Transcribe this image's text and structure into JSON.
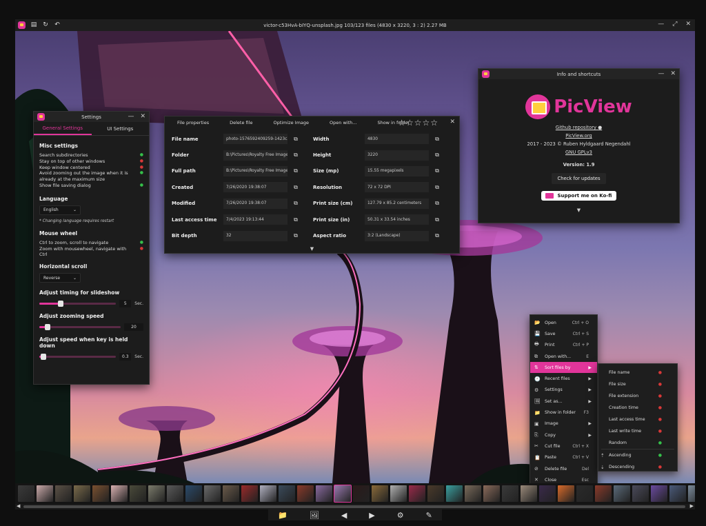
{
  "window": {
    "title": "victor-c53HvA-bIYQ-unsplash.jpg 103/123 files (4830 x 3220, 3 : 2) 2.27 MB",
    "controls": [
      "—",
      "⤢",
      "✕"
    ]
  },
  "settings": {
    "title": "Settings",
    "tabs": [
      "General Settings",
      "UI Settings"
    ],
    "misc_heading": "Misc settings",
    "misc_items": [
      {
        "label": "Search subdirectories",
        "on": true
      },
      {
        "label": "Stay on top of other windows",
        "on": false
      },
      {
        "label": "Keep window centered",
        "on": false
      },
      {
        "label": "Avoid zooming out the image when it is already at the maximum size",
        "on": true
      },
      {
        "label": "Show file saving dialog",
        "on": true
      }
    ],
    "language_heading": "Language",
    "language_value": "English",
    "language_note": "* Changing language requires restart",
    "mouse_heading": "Mouse wheel",
    "mouse_items": [
      {
        "label": "Ctrl to zoom, scroll to navigate",
        "on": true
      },
      {
        "label": "Zoom with mousewheel, navigate with Ctrl",
        "on": false
      }
    ],
    "hscroll_heading": "Horizontal scroll",
    "hscroll_value": "Reverse",
    "slideshow_heading": "Adjust timing for slideshow",
    "slideshow_value": "5",
    "slideshow_unit": "Sec.",
    "slideshow_level": 0.28,
    "zoom_heading": "Adjust zooming speed",
    "zoom_value": "20",
    "zoom_level": 0.1,
    "key_heading": "Adjust speed when key is held down",
    "key_value": "0.3",
    "key_unit": "Sec.",
    "key_level": 0.05
  },
  "fileprops": {
    "toolbar": [
      "File properties",
      "Delete file",
      "Optimize Image",
      "Open with...",
      "Show in folder"
    ],
    "stars": "☆☆☆☆☆",
    "left": [
      {
        "label": "File name",
        "value": "photo-1576592409259-1423c3f"
      },
      {
        "label": "Folder",
        "value": "B:\\Pictures\\Royalty Free Images"
      },
      {
        "label": "Full path",
        "value": "B:\\Pictures\\Royalty Free Images"
      },
      {
        "label": "Created",
        "value": "7/26/2020 19:38:07"
      },
      {
        "label": "Modified",
        "value": "7/26/2020 19:38:07"
      },
      {
        "label": "Last access time",
        "value": "7/4/2023 19:13:44"
      },
      {
        "label": "Bit depth",
        "value": "32"
      }
    ],
    "right": [
      {
        "label": "Width",
        "value": "4830"
      },
      {
        "label": "Height",
        "value": "3220"
      },
      {
        "label": "Size (mp)",
        "value": "15.55 megapixels"
      },
      {
        "label": "Resolution",
        "value": "72 x 72 DPI"
      },
      {
        "label": "Print size (cm)",
        "value": "127.79 x 85.2 centimeters"
      },
      {
        "label": "Print size (in)",
        "value": "50.31 x 33.54 inches"
      },
      {
        "label": "Aspect ratio",
        "value": "3:2 (Landscape)"
      }
    ]
  },
  "info": {
    "title": "Info and shortcuts",
    "app_name": "PicView",
    "github": "Github repository",
    "website": "PicView.org",
    "copyright": "2017 - 2023 © Ruben Hyldgaard Negendahl",
    "license": "GNU GPLv3",
    "version": "Version: 1.9",
    "check_updates": "Check for updates",
    "kofi": "Support me on Ko-fi"
  },
  "context_menu": [
    {
      "icon": "📂",
      "label": "Open",
      "key": "Ctrl + O",
      "sub": false
    },
    {
      "icon": "💾",
      "label": "Save",
      "key": "Ctrl + S",
      "sub": false
    },
    {
      "icon": "🖶",
      "label": "Print",
      "key": "Ctrl + P",
      "sub": false
    },
    {
      "icon": "⧉",
      "label": "Open with...",
      "key": "E",
      "sub": false
    },
    {
      "icon": "⇅",
      "label": "Sort files by",
      "key": "",
      "sub": true,
      "active": true
    },
    {
      "icon": "🕘",
      "label": "Recent files",
      "key": "",
      "sub": true
    },
    {
      "icon": "⚙",
      "label": "Settings",
      "key": "",
      "sub": true
    },
    {
      "icon": "🖼",
      "label": "Set as...",
      "key": "",
      "sub": true
    },
    {
      "icon": "📁",
      "label": "Show in folder",
      "key": "F3",
      "sub": false
    },
    {
      "icon": "▣",
      "label": "Image",
      "key": "",
      "sub": true
    },
    {
      "icon": "⎘",
      "label": "Copy",
      "key": "",
      "sub": true
    },
    {
      "icon": "✂",
      "label": "Cut file",
      "key": "Ctrl + X",
      "sub": false
    },
    {
      "icon": "📋",
      "label": "Paste",
      "key": "Ctrl + V",
      "sub": false
    },
    {
      "icon": "⊘",
      "label": "Delete file",
      "key": "Del",
      "sub": false
    },
    {
      "icon": "✕",
      "label": "Close",
      "key": "Esc",
      "sub": false
    }
  ],
  "sort_menu": {
    "items": [
      {
        "label": "File name",
        "on": false
      },
      {
        "label": "File size",
        "on": false
      },
      {
        "label": "File extension",
        "on": false
      },
      {
        "label": "Creation time",
        "on": false
      },
      {
        "label": "Last access time",
        "on": false
      },
      {
        "label": "Last write time",
        "on": false
      },
      {
        "label": "Random",
        "on": true
      }
    ],
    "order": [
      {
        "label": "Ascending",
        "on": true
      },
      {
        "label": "Descending",
        "on": false
      }
    ]
  },
  "thumbnails": [
    "#3a3a3a",
    "#c9a9a9",
    "#5a5045",
    "#7a6a4a",
    "#7a5030",
    "#d9b0b0",
    "#4a4a3a",
    "#7b7b6b",
    "#5a5a5a",
    "#2a4a6a",
    "#6a6a6a",
    "#6a5a4a",
    "#9a2a2a",
    "#b0b0c0",
    "#3a4a5a",
    "#8a3a2a",
    "#8a6aa0",
    "#9a7ab0",
    "#2a1a1a",
    "#8a6a3a",
    "#b0b0b0",
    "#9a2a4a",
    "#4a3a2a",
    "#3aa0a0",
    "#7a6a5a",
    "#8a6a5a",
    "#3a3a3a",
    "#9a8a7a",
    "#3a2a4a",
    "#d86a2a",
    "#2a2a2a",
    "#8a3a2a",
    "#5a6a7a",
    "#4a4a5a",
    "#6a4aa0",
    "#4a5a7a",
    "#7a8a9a",
    "#4a6a3a",
    "#9a7a5a",
    "#8a5a3a",
    "#3a3a4a",
    "#a06a4a",
    "#7a5a7a",
    "#4a7a8a",
    "#6a6a4a",
    "#9aa0a0"
  ],
  "thumb_selected_index": 17,
  "bottom_buttons": [
    "📁",
    "🖼",
    "◀",
    "▶",
    "⚙",
    "✎"
  ]
}
